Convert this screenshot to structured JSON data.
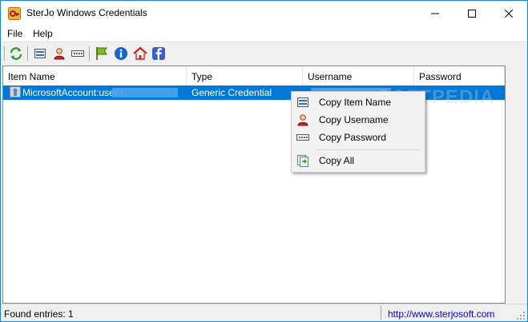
{
  "window": {
    "title": "SterJo Windows Credentials",
    "icons": {
      "app": "key-app-icon",
      "minimize": "minimize-icon",
      "maximize": "maximize-icon",
      "close": "close-icon"
    }
  },
  "menu": {
    "file": "File",
    "help": "Help"
  },
  "toolbar": {
    "buttons": [
      "refresh-icon",
      "copy-item-name-icon",
      "copy-username-icon",
      "copy-password-icon",
      "flag-icon",
      "info-icon",
      "home-icon",
      "facebook-icon"
    ]
  },
  "table": {
    "columns": [
      "Item Name",
      "Type",
      "Username",
      "Password"
    ],
    "rows": [
      {
        "item_name": "MicrosoftAccount:user=",
        "type": "Generic Credential",
        "username": "",
        "password": ""
      }
    ],
    "selected_color": "#0078d7"
  },
  "context_menu": {
    "items": [
      {
        "label": "Copy Item Name",
        "icon": "copy-item-name-icon"
      },
      {
        "label": "Copy Username",
        "icon": "user-icon"
      },
      {
        "label": "Copy Password",
        "icon": "password-icon"
      },
      {
        "label": "Copy All",
        "icon": "copy-all-icon"
      }
    ]
  },
  "status": {
    "found": "Found entries: 1",
    "link": "http://www.sterjosoft.com"
  },
  "watermark": "SOFTPEDIA"
}
